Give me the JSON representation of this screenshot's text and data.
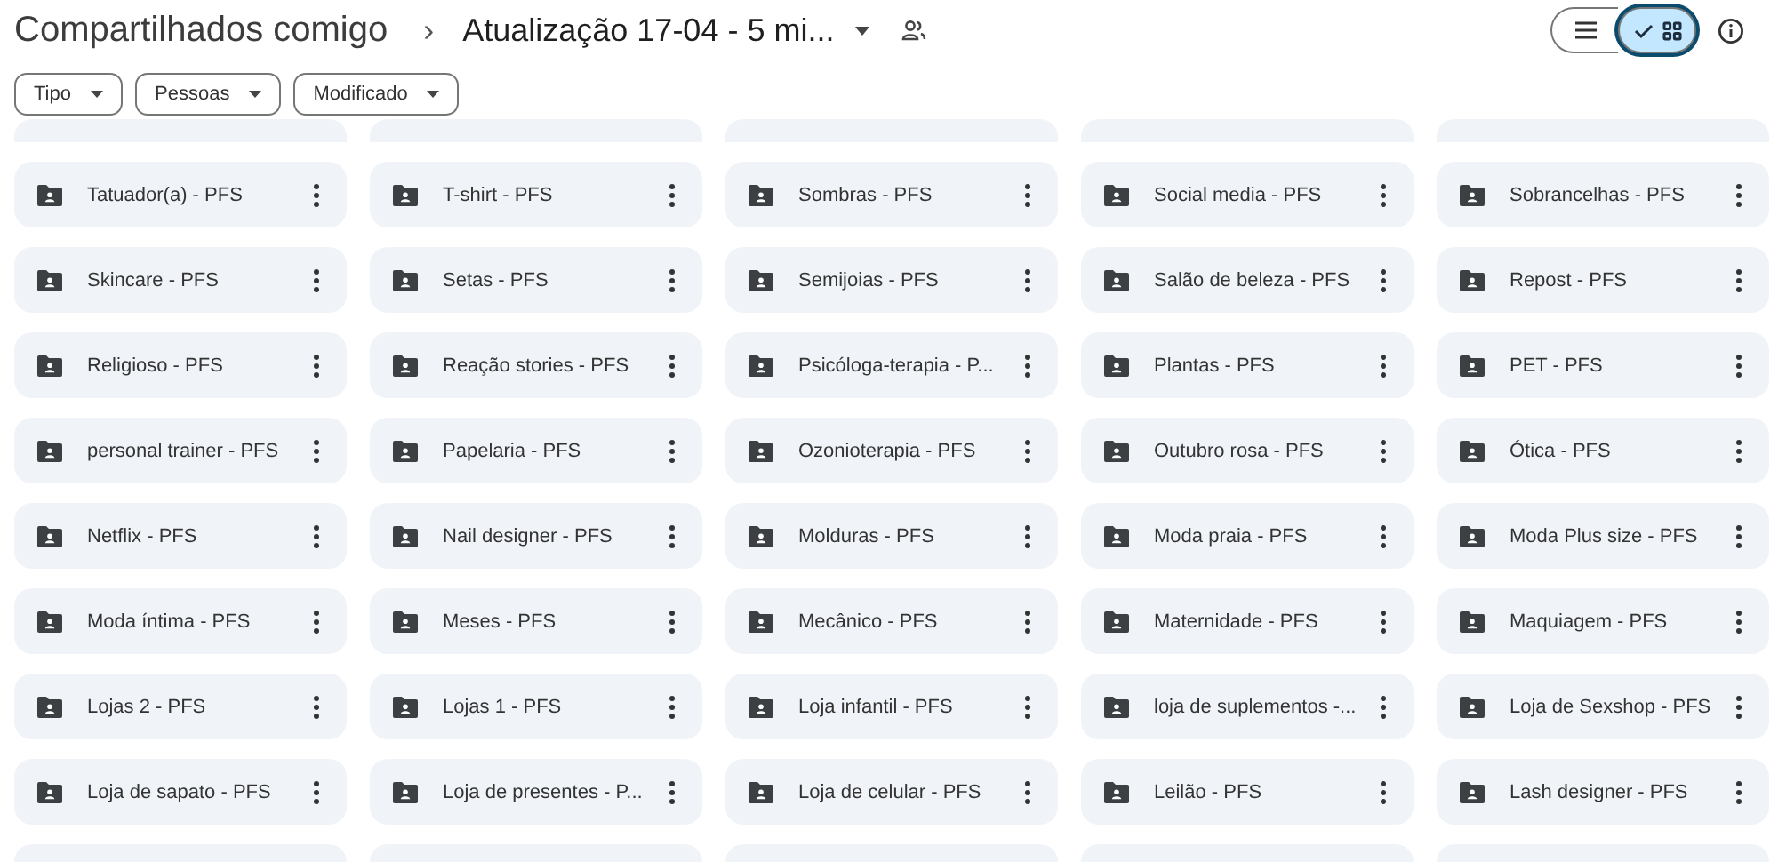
{
  "breadcrumb": {
    "root": "Compartilhados comigo",
    "separator": "›",
    "current": "Atualização 17-04 - 5 mi..."
  },
  "view_toggle": [
    {
      "kind": "list",
      "selected": false
    },
    {
      "kind": "grid",
      "selected": true
    }
  ],
  "filters": [
    {
      "label": "Tipo"
    },
    {
      "label": "Pessoas"
    },
    {
      "label": "Modificado"
    }
  ],
  "folders": [
    {
      "name": "Tatuador(a) - PFS"
    },
    {
      "name": "T-shirt - PFS"
    },
    {
      "name": "Sombras - PFS"
    },
    {
      "name": "Social media - PFS"
    },
    {
      "name": "Sobrancelhas - PFS"
    },
    {
      "name": "Skincare - PFS"
    },
    {
      "name": "Setas - PFS"
    },
    {
      "name": "Semijoias - PFS"
    },
    {
      "name": "Salão de beleza - PFS"
    },
    {
      "name": "Repost - PFS"
    },
    {
      "name": "Religioso - PFS"
    },
    {
      "name": "Reação stories - PFS"
    },
    {
      "name": "Psicóloga-terapia - P..."
    },
    {
      "name": "Plantas - PFS"
    },
    {
      "name": "PET - PFS"
    },
    {
      "name": "personal trainer - PFS"
    },
    {
      "name": "Papelaria - PFS"
    },
    {
      "name": "Ozonioterapia - PFS"
    },
    {
      "name": "Outubro rosa - PFS"
    },
    {
      "name": "Ótica - PFS"
    },
    {
      "name": "Netflix - PFS"
    },
    {
      "name": "Nail designer - PFS"
    },
    {
      "name": "Molduras - PFS"
    },
    {
      "name": "Moda praia - PFS"
    },
    {
      "name": "Moda Plus size - PFS"
    },
    {
      "name": "Moda íntima - PFS"
    },
    {
      "name": "Meses - PFS"
    },
    {
      "name": "Mecânico - PFS"
    },
    {
      "name": "Maternidade - PFS"
    },
    {
      "name": "Maquiagem - PFS"
    },
    {
      "name": "Lojas 2 - PFS"
    },
    {
      "name": "Lojas 1 - PFS"
    },
    {
      "name": "Loja infantil - PFS"
    },
    {
      "name": "loja de suplementos -..."
    },
    {
      "name": "Loja de Sexshop - PFS"
    },
    {
      "name": "Loja de sapato - PFS"
    },
    {
      "name": "Loja de presentes - P..."
    },
    {
      "name": "Loja de celular - PFS"
    },
    {
      "name": "Leilão - PFS"
    },
    {
      "name": "Lash designer - PFS"
    }
  ]
}
